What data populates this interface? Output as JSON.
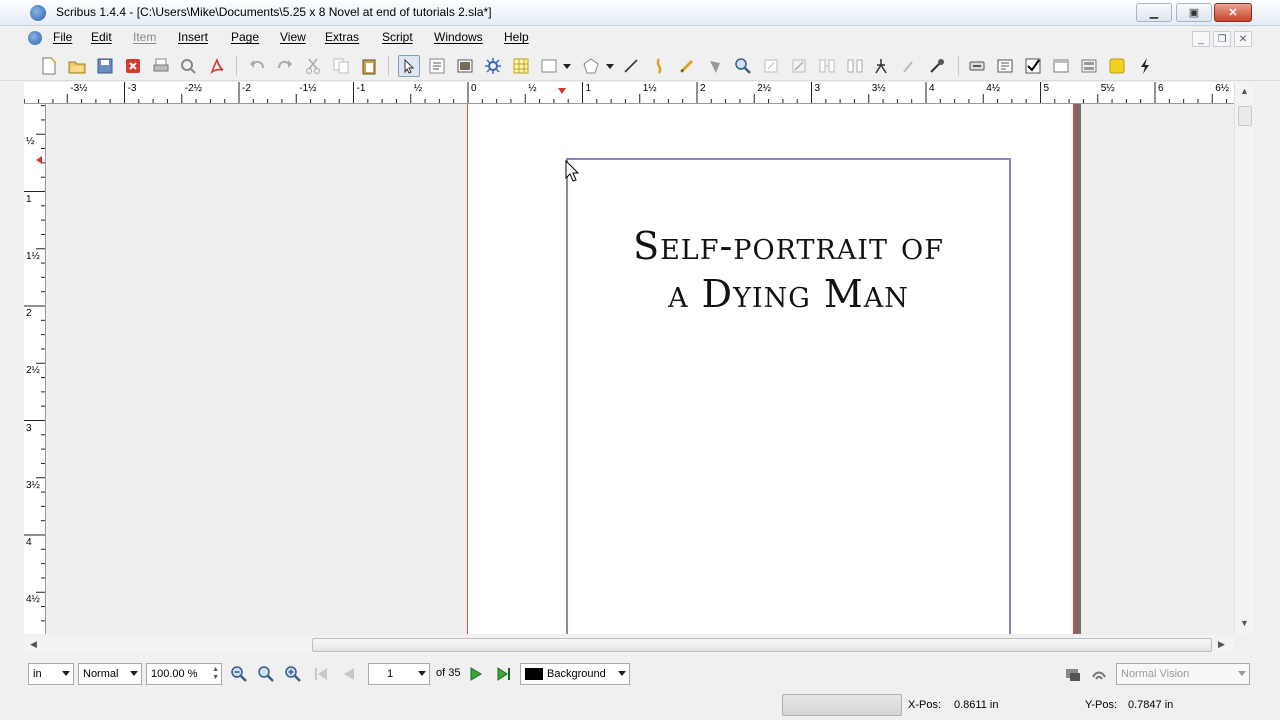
{
  "window": {
    "title": "Scribus 1.4.4 - [C:\\Users\\Mike\\Documents\\5.25 x 8 Novel at end of tutorials 2.sla*]",
    "minimize": "▁",
    "maximize": "▣",
    "close": "✕"
  },
  "menu": {
    "items": [
      {
        "label": "File",
        "enabled": true
      },
      {
        "label": "Edit",
        "enabled": true
      },
      {
        "label": "Item",
        "enabled": false
      },
      {
        "label": "Insert",
        "enabled": true
      },
      {
        "label": "Page",
        "enabled": true
      },
      {
        "label": "View",
        "enabled": true
      },
      {
        "label": "Extras",
        "enabled": true
      },
      {
        "label": "Script",
        "enabled": true
      },
      {
        "label": "Windows",
        "enabled": true
      },
      {
        "label": "Help",
        "enabled": true
      }
    ],
    "mdi_minimize": "_",
    "mdi_restore": "❐",
    "mdi_close": "✕"
  },
  "toolbar": {
    "icons": [
      "new-document-icon",
      "open-icon",
      "save-icon",
      "close-document-icon",
      "print-icon",
      "preflight-icon",
      "export-pdf-icon",
      "undo-icon",
      "redo-icon",
      "cut-icon",
      "copy-icon",
      "paste-icon",
      "select-icon",
      "text-frame-icon",
      "image-frame-icon",
      "render-frame-icon",
      "table-icon",
      "shape-icon",
      "polygon-icon",
      "line-icon",
      "bezier-icon",
      "freehand-icon",
      "rotate-icon",
      "zoom-icon",
      "edit-text-icon",
      "story-editor-icon",
      "link-frames-icon",
      "unlink-frames-icon",
      "measure-icon",
      "copy-properties-icon",
      "eyedropper-icon",
      "pdf-button-icon",
      "pdf-textfield-icon",
      "pdf-checkbox-icon",
      "pdf-combobox-icon",
      "pdf-listbox-icon",
      "pdf-annotation-icon",
      "pdf-link-icon"
    ]
  },
  "rulers": {
    "horizontal_labels": [
      "-3½",
      "-3",
      "-2½",
      "-2",
      "-1½",
      "-1",
      "½",
      "0",
      "½",
      "1",
      "1½",
      "2",
      "2½",
      "3",
      "3½",
      "4",
      "4½",
      "5",
      "5½",
      "6",
      "6½"
    ],
    "vertical_labels": [
      "½",
      "1",
      "1½",
      "2",
      "2½",
      "3",
      "3½",
      "4",
      "4½"
    ]
  },
  "document": {
    "title_line1": "Self-portrait of",
    "title_line2": "a Dying Man"
  },
  "status": {
    "unit": "in",
    "zoom_mode": "Normal",
    "zoom_value": "100.00 %",
    "current_page": "1",
    "page_of": "of 35",
    "layer": "Background",
    "layer_color": "#000000",
    "vision": "Normal Vision",
    "xpos_label": "X-Pos:",
    "xpos_value": "0.8611 in",
    "ypos_label": "Y-Pos:",
    "ypos_value": "0.7847 in"
  },
  "colors": {
    "margin_red": "#e05050",
    "frame_border": "#8a84c0",
    "accent_green": "#3aa63a"
  }
}
